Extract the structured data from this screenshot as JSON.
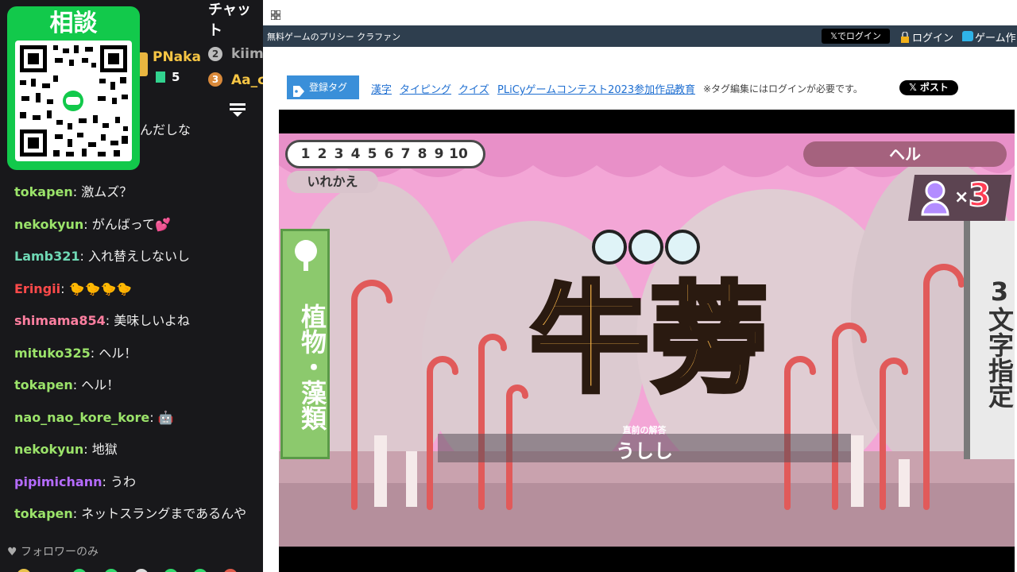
{
  "chat": {
    "header": "チャット",
    "qr_title": "相談",
    "leaderboard": {
      "first_name": "PNaka",
      "first_count": "5",
      "second_rank": "2",
      "second_name": "kiima",
      "third_rank": "3",
      "third_name": "Aa_c"
    },
    "partial_message": "んだしな",
    "messages": [
      {
        "user": "tokapen",
        "color": "#9be36a",
        "text": " 激ムズ？"
      },
      {
        "user": "nekokyun",
        "color": "#9be36a",
        "text": " がんばって💕"
      },
      {
        "user": "Lamb321",
        "color": "#6fd9b5",
        "text": " 入れ替えしないし"
      },
      {
        "user": "Eringii",
        "color": "#ff4a4a",
        "text": " 🐤🐤🐤🐤"
      },
      {
        "user": "shimama854",
        "color": "#ff7fa0",
        "text": " 美味しいよね"
      },
      {
        "user": "mituko325",
        "color": "#9be36a",
        "text": " ヘル！"
      },
      {
        "user": "tokapen",
        "color": "#9be36a",
        "text": " ヘル！"
      },
      {
        "user": "nao_nao_kore_kore",
        "color": "#9be36a",
        "text": " 🤖"
      },
      {
        "user": "nekokyun",
        "color": "#9be36a",
        "text": " 地獄"
      },
      {
        "user": "pipimichann",
        "color": "#b56bff",
        "text": " うわ"
      },
      {
        "user": "tokapen",
        "color": "#9be36a",
        "text": " ネットスラングまであるんや"
      }
    ],
    "follower_only": "フォロワーのみ"
  },
  "browser": {
    "site_title": "無料ゲームのプリシー クラファン",
    "x_login": "𝕏でログイン",
    "login": "ログイン",
    "game_create": "ゲーム作",
    "tag_label": "登録タグ",
    "tags": [
      "漢字",
      "タイピング",
      "クイズ",
      "PLiCyゲームコンテスト2023参加作品",
      "教育"
    ],
    "tag_note": "※タグ編集にはログインが必要です。",
    "post_button": "𝕏 ポスト"
  },
  "game": {
    "numbers": [
      "1",
      "2",
      "3",
      "4",
      "5",
      "6",
      "7",
      "8",
      "9",
      "10"
    ],
    "swap_button": "いれかえ",
    "difficulty": "ヘル",
    "lives_symbol": "×",
    "lives": "3",
    "category": "植物・藻類",
    "kanji": "牛蒡",
    "constraint": "3文字指定",
    "previous_label": "直前の解答",
    "previous_answer": "うしし"
  },
  "colors": {
    "chat_bg": "#18181b",
    "qr_green": "#12c94b",
    "nav_bg": "#2e3e4e",
    "game_pink": "#f3a6d6",
    "kanji_orange": "#f7b448",
    "tag_blue": "#3a8fd9"
  }
}
